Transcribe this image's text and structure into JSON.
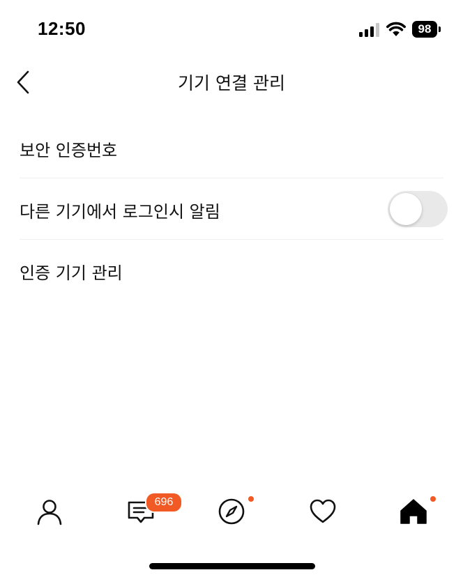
{
  "status_bar": {
    "time": "12:50",
    "battery": "98",
    "icons": [
      "signal-icon",
      "wifi-icon",
      "battery-icon"
    ]
  },
  "header": {
    "title": "기기 연결 관리",
    "back_icon": "chevron-left-icon"
  },
  "settings": {
    "items": [
      {
        "label": "보안 인증번호"
      },
      {
        "label": "다른 기기에서 로그인시 알림",
        "toggle_on": false
      },
      {
        "label": "인증 기기 관리"
      }
    ]
  },
  "tab_bar": {
    "tabs": [
      {
        "icon": "person-icon"
      },
      {
        "icon": "chat-icon",
        "badge": "696"
      },
      {
        "icon": "compass-icon",
        "dot": true
      },
      {
        "icon": "heart-icon"
      },
      {
        "icon": "home-icon",
        "dot": true,
        "active": true
      }
    ]
  },
  "colors": {
    "accent": "#f15a24",
    "toggle_off": "#e9e9ea",
    "divider": "#efefef"
  }
}
